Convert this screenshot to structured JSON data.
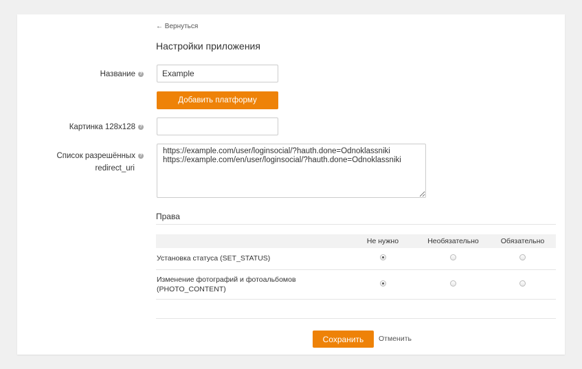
{
  "nav": {
    "back_label": "← Вернуться"
  },
  "page": {
    "title": "Настройки приложения"
  },
  "form": {
    "name_label": "Название",
    "name_value": "Example",
    "add_platform_label": "Добавить платформу",
    "picture_label": "Картинка 128x128",
    "picture_value": "",
    "redirect_label_line1": "Список разрешённых",
    "redirect_label_line2": "redirect_uri",
    "redirect_value": "https://example.com/user/loginsocial/?hauth.done=Odnoklassniki\nhttps://example.com/en/user/loginsocial/?hauth.done=Odnoklassniki",
    "help_glyph": "?"
  },
  "permissions": {
    "title": "Права",
    "columns": [
      "Не нужно",
      "Необязательно",
      "Обязательно"
    ],
    "rows": [
      {
        "line1": "Установка статуса (SET_STATUS)",
        "line2": "",
        "selected": 0
      },
      {
        "line1": "Изменение фотографий и фотоальбомов",
        "line2": "(PHOTO_CONTENT)",
        "selected": 0
      }
    ]
  },
  "footer": {
    "save_label": "Сохранить",
    "cancel_label": "Отменить"
  },
  "colors": {
    "accent": "#ee8208",
    "background": "#f0f0f0",
    "card": "#ffffff"
  }
}
